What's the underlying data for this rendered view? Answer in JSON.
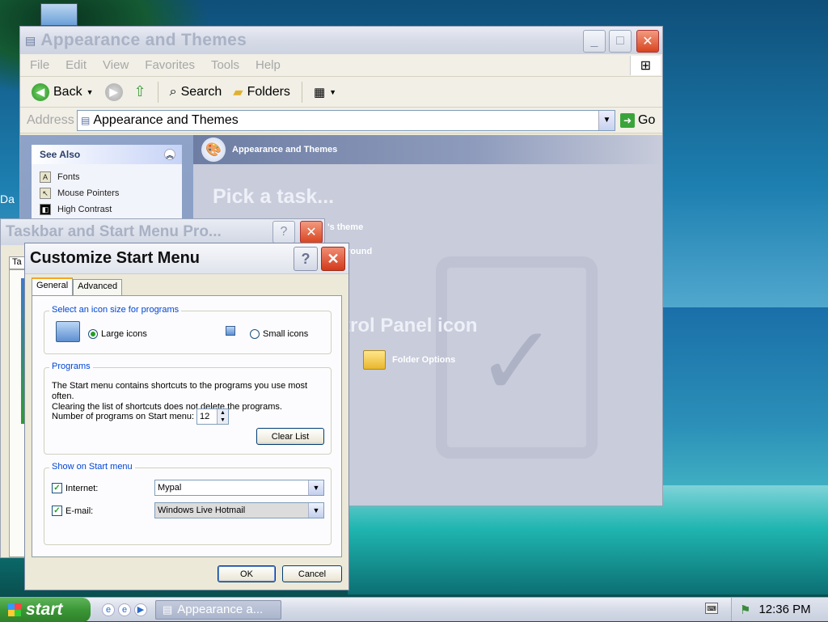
{
  "desktop": {
    "partial_icon_text": "Da"
  },
  "explorer": {
    "title": "Appearance and Themes",
    "menu": [
      "File",
      "Edit",
      "View",
      "Favorites",
      "Tools",
      "Help"
    ],
    "toolbar": {
      "back": "Back",
      "search": "Search",
      "folders": "Folders"
    },
    "address": {
      "label": "Address",
      "value": "Appearance and Themes",
      "go": "Go"
    },
    "see_also": {
      "title": "See Also",
      "items": [
        "Fonts",
        "Mouse Pointers",
        "High Contrast"
      ]
    },
    "banner": "Appearance and Themes",
    "pick_task": "Pick a task...",
    "task1": "'s theme",
    "task2": "round",
    "cp_icon_heading": "trol Panel icon",
    "folder_options": "Folder Options"
  },
  "taskbar_props": {
    "title": "Taskbar and Start Menu Pro...",
    "tab_partial": "Ta"
  },
  "customize": {
    "title": "Customize Start Menu",
    "tabs": [
      "General",
      "Advanced"
    ],
    "icon_group": {
      "legend": "Select an icon size for programs",
      "large": "Large icons",
      "small": "Small icons",
      "selected": "large"
    },
    "programs": {
      "legend": "Programs",
      "desc1": "The Start menu contains shortcuts to the programs you use most often.",
      "desc2": "Clearing the list of shortcuts does not delete the programs.",
      "count_label": "Number of programs on Start menu:",
      "count_value": "12",
      "clear_btn": "Clear List"
    },
    "show": {
      "legend": "Show on Start menu",
      "internet_label": "Internet:",
      "internet_value": "Mypal",
      "email_label": "E-mail:",
      "email_value": "Windows Live Hotmail"
    },
    "ok": "OK",
    "cancel": "Cancel"
  },
  "taskbar": {
    "start": "start",
    "task": "Appearance a...",
    "clock": "12:36 PM"
  }
}
